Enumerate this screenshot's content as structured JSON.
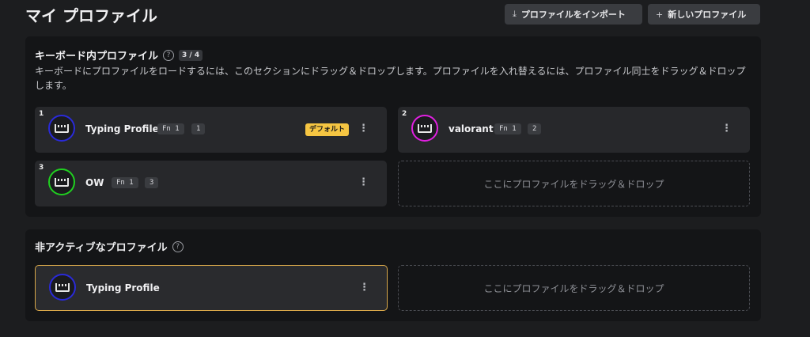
{
  "header": {
    "title": "マイ プロファイル",
    "import_label": "プロファイルをインポート",
    "new_label": "新しいプロファイル"
  },
  "keyboard_section": {
    "title": "キーボード内プロファイル",
    "count": "3 / 4",
    "description": "キーボードにプロファイルをロードするには、このセクションにドラッグ＆ドロップします。プロファイルを入れ替えるには、プロファイル同士をドラッグ＆ドロップします。",
    "profiles": [
      {
        "slot": "1",
        "name": "Typing Profile",
        "fn": "Fn 1",
        "layer": "1",
        "badge": "デフォルト",
        "color": "#2a2ad8"
      },
      {
        "slot": "2",
        "name": "valorant",
        "fn": "Fn 1",
        "layer": "2",
        "color": "#e020e0"
      },
      {
        "slot": "3",
        "name": "OW",
        "fn": "Fn 1",
        "layer": "3",
        "color": "#20d020"
      }
    ],
    "dropzone": "ここにプロファイルをドラッグ＆ドロップ"
  },
  "inactive_section": {
    "title": "非アクティブなプロファイル",
    "profiles": [
      {
        "name": "Typing Profile",
        "color": "#2a2ad8"
      }
    ],
    "dropzone": "ここにプロファイルをドラッグ＆ドロップ"
  }
}
